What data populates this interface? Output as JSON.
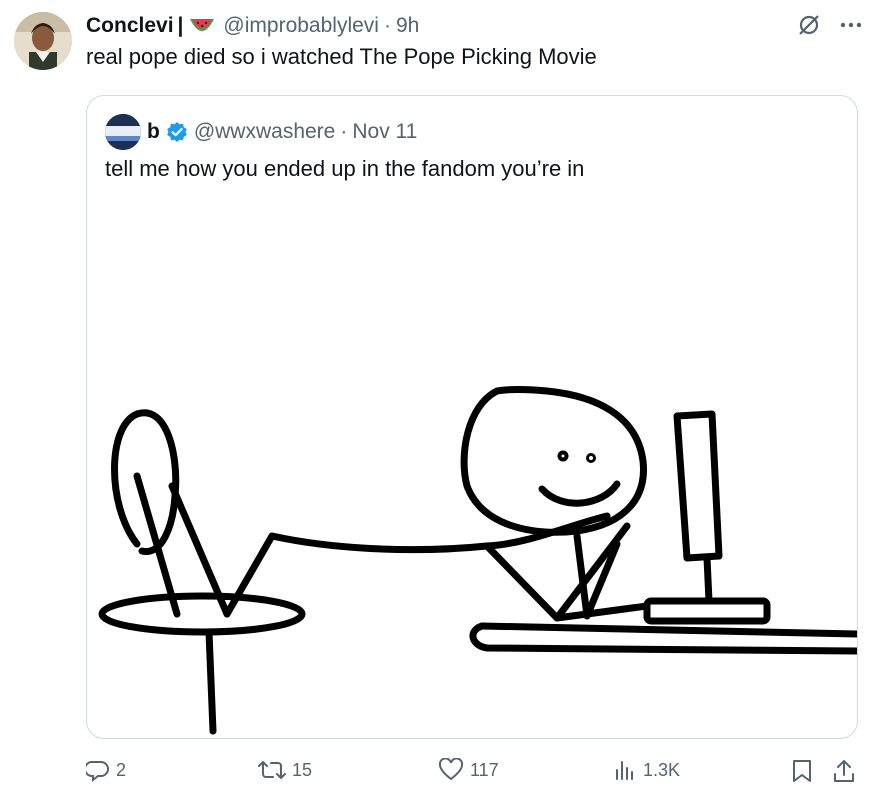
{
  "tweet": {
    "author_name": "Conclevi",
    "separator": "|",
    "handle": "@improbablylevi",
    "dot": "·",
    "time": "9h",
    "text": "real pope died so i watched The Pope Picking Movie"
  },
  "quote": {
    "author_name": "b",
    "handle": "@wwxwashere",
    "dot": "·",
    "date": "Nov 11",
    "text": "tell me how you ended up in the fandom you’re in"
  },
  "actions": {
    "replies": "2",
    "reposts": "15",
    "likes": "117",
    "views": "1.3K"
  },
  "icons": [
    "watermelon-icon",
    "grok-icon",
    "more-icon",
    "verified-badge-icon",
    "reply-icon",
    "repost-icon",
    "like-icon",
    "views-icon",
    "bookmark-icon",
    "share-icon"
  ],
  "colors": {
    "text": "#0f1419",
    "secondary": "#536471",
    "border": "#cfd9de",
    "verified": "#1d9bf0"
  }
}
